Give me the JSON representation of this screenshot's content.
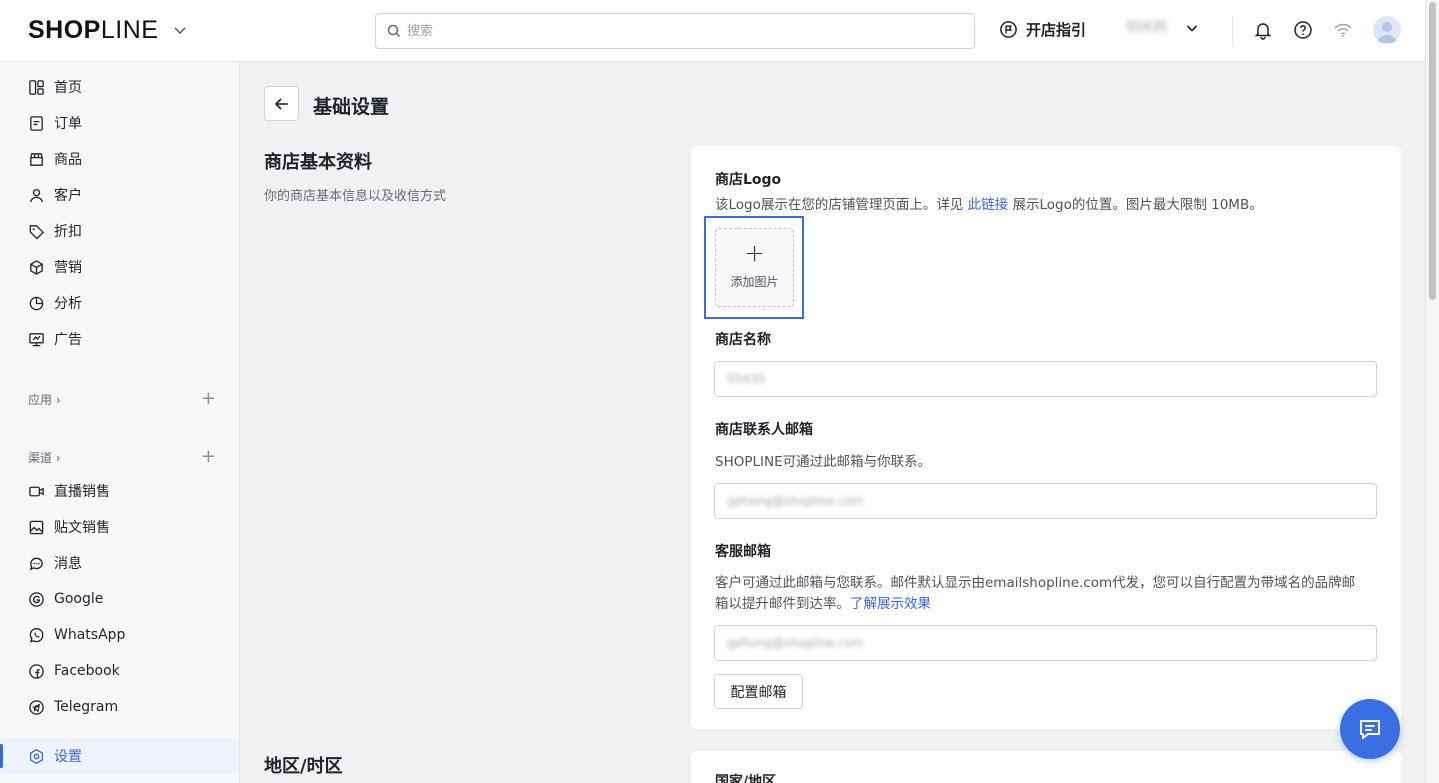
{
  "topbar": {
    "brand_bold": "SHOP",
    "brand_light": "LINE",
    "search_placeholder": "搜索",
    "guide_label": "开店指引",
    "store_name": "55435"
  },
  "sidebar": {
    "items": [
      {
        "label": "首页",
        "icon": "home-icon"
      },
      {
        "label": "订单",
        "icon": "order-icon"
      },
      {
        "label": "商品",
        "icon": "product-icon"
      },
      {
        "label": "客户",
        "icon": "customer-icon"
      },
      {
        "label": "折扣",
        "icon": "discount-tag-icon"
      },
      {
        "label": "营销",
        "icon": "marketing-cube-icon"
      },
      {
        "label": "分析",
        "icon": "analytics-pie-icon"
      },
      {
        "label": "广告",
        "icon": "ads-icon"
      }
    ],
    "apps_label": "应用",
    "channels_label": "渠道",
    "channels": [
      {
        "label": "直播销售",
        "icon": "live-video-icon"
      },
      {
        "label": "贴文销售",
        "icon": "post-image-icon"
      },
      {
        "label": "消息",
        "icon": "message-icon"
      },
      {
        "label": "Google",
        "icon": "google-icon"
      },
      {
        "label": "WhatsApp",
        "icon": "whatsapp-icon"
      },
      {
        "label": "Facebook",
        "icon": "facebook-icon"
      },
      {
        "label": "Telegram",
        "icon": "telegram-icon"
      }
    ],
    "settings_label": "设置"
  },
  "main": {
    "page_title": "基础设置",
    "section_title": "商店基本资料",
    "section_desc": "你的商店基本信息以及收信方式",
    "logo_label": "商店Logo",
    "logo_hint_pre": "该Logo展示在您的店铺管理页面上。详见 ",
    "logo_hint_link": "此链接",
    "logo_hint_post": " 展示Logo的位置。图片最大限制 10MB。",
    "upload_label": "添加图片",
    "store_name_label": "商店名称",
    "store_name_value": "55435",
    "contact_email_label": "商店联系人邮箱",
    "contact_email_hint": "SHOPLINE可通过此邮箱与你联系。",
    "contact_email_value": "gehong@shopline.com",
    "service_email_label": "客服邮箱",
    "service_email_hint_line1": "客户可通过此邮箱与您联系。邮件默认显示由emailshopline.com代发，您可以自行配置为带域名的品牌邮",
    "service_email_hint_line2": "箱以提升邮件到达率。",
    "service_email_link": "了解展示效果",
    "service_email_value": "gehong@shopline.com",
    "config_button": "配置邮箱",
    "region_title": "地区/时区",
    "country_label": "国家/地区"
  },
  "colors": {
    "accent": "#3a66e0",
    "highlight_outline": "#3a6fe3",
    "chat_fab": "#3a6fe3"
  }
}
